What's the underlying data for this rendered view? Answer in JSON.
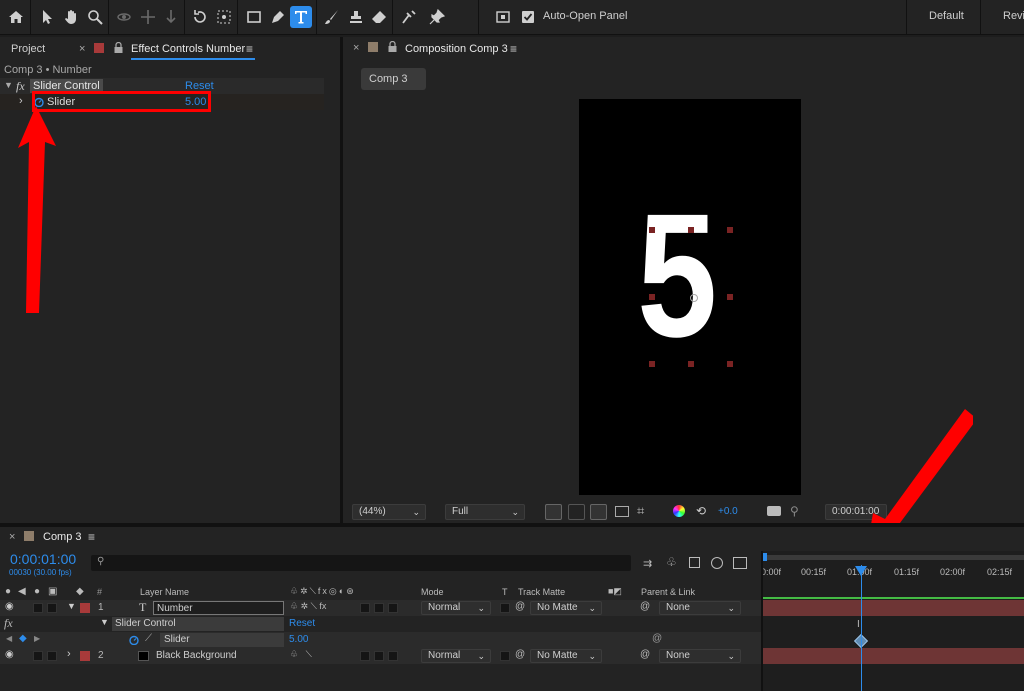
{
  "toolbar": {
    "auto_open_panel": "Auto-Open Panel",
    "workspace_default": "Default",
    "workspace_review": "Revi"
  },
  "left_panel": {
    "tab_project": "Project",
    "tab_effect_controls": "Effect Controls Number",
    "breadcrumb": "Comp 3 • Number",
    "fx_label": "fx",
    "effect_name": "Slider Control",
    "reset": "Reset",
    "property_name": "Slider",
    "property_value": "5.00"
  },
  "viewer": {
    "tab_title": "Composition Comp 3",
    "comp_tab": "Comp 3",
    "canvas_text": "5",
    "zoom": "(44%)",
    "resolution": "Full",
    "exposure": "+0.0",
    "timecode": "0:00:01:00"
  },
  "timeline": {
    "tab": "Comp 3",
    "timecode": "0:00:01:00",
    "fps": "00030 (30.00 fps)",
    "search_icon_label": "P",
    "columns": {
      "num": "#",
      "layer_name": "Layer Name",
      "mode": "Mode",
      "t": "T",
      "track_matte": "Track Matte",
      "parent": "Parent & Link"
    },
    "ruler": [
      "0:00f",
      "00:15f",
      "01:00f",
      "01:15f",
      "02:00f",
      "02:15f"
    ],
    "layer1": {
      "num": "1",
      "name": "Number",
      "mode": "Normal",
      "matte": "No Matte",
      "parent": "None"
    },
    "effect_row": {
      "fx": "fx",
      "name": "Slider Control",
      "reset": "Reset"
    },
    "slider_row": {
      "name": "Slider",
      "value": "5.00"
    },
    "layer2": {
      "num": "2",
      "name": "Black Background",
      "mode": "Normal",
      "matte": "No Matte",
      "parent": "None"
    }
  },
  "colors": {
    "accent": "#2d8ceb",
    "annotation": "#ff0000",
    "layer_label_red": "#a83a3a",
    "bar_red": "#6e3535"
  }
}
